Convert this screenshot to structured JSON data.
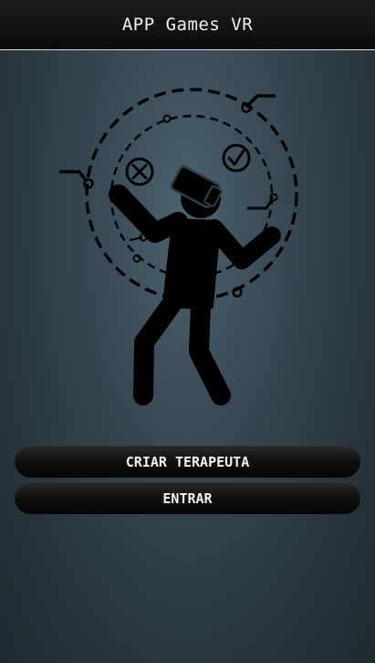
{
  "header": {
    "title": "APP Games VR"
  },
  "illustration": {
    "icon": "vr-player-juggling-icon",
    "foreground_color": "#000000"
  },
  "actions": {
    "create_therapist_label": "CRIAR TERAPEUTA",
    "enter_label": "ENTRAR"
  },
  "colors": {
    "header_bg": "#0b0b0b",
    "header_text": "#f2f2f2",
    "background": "#34444d",
    "button_bg": "#0d0d0d",
    "button_text": "#f4f4f4"
  }
}
